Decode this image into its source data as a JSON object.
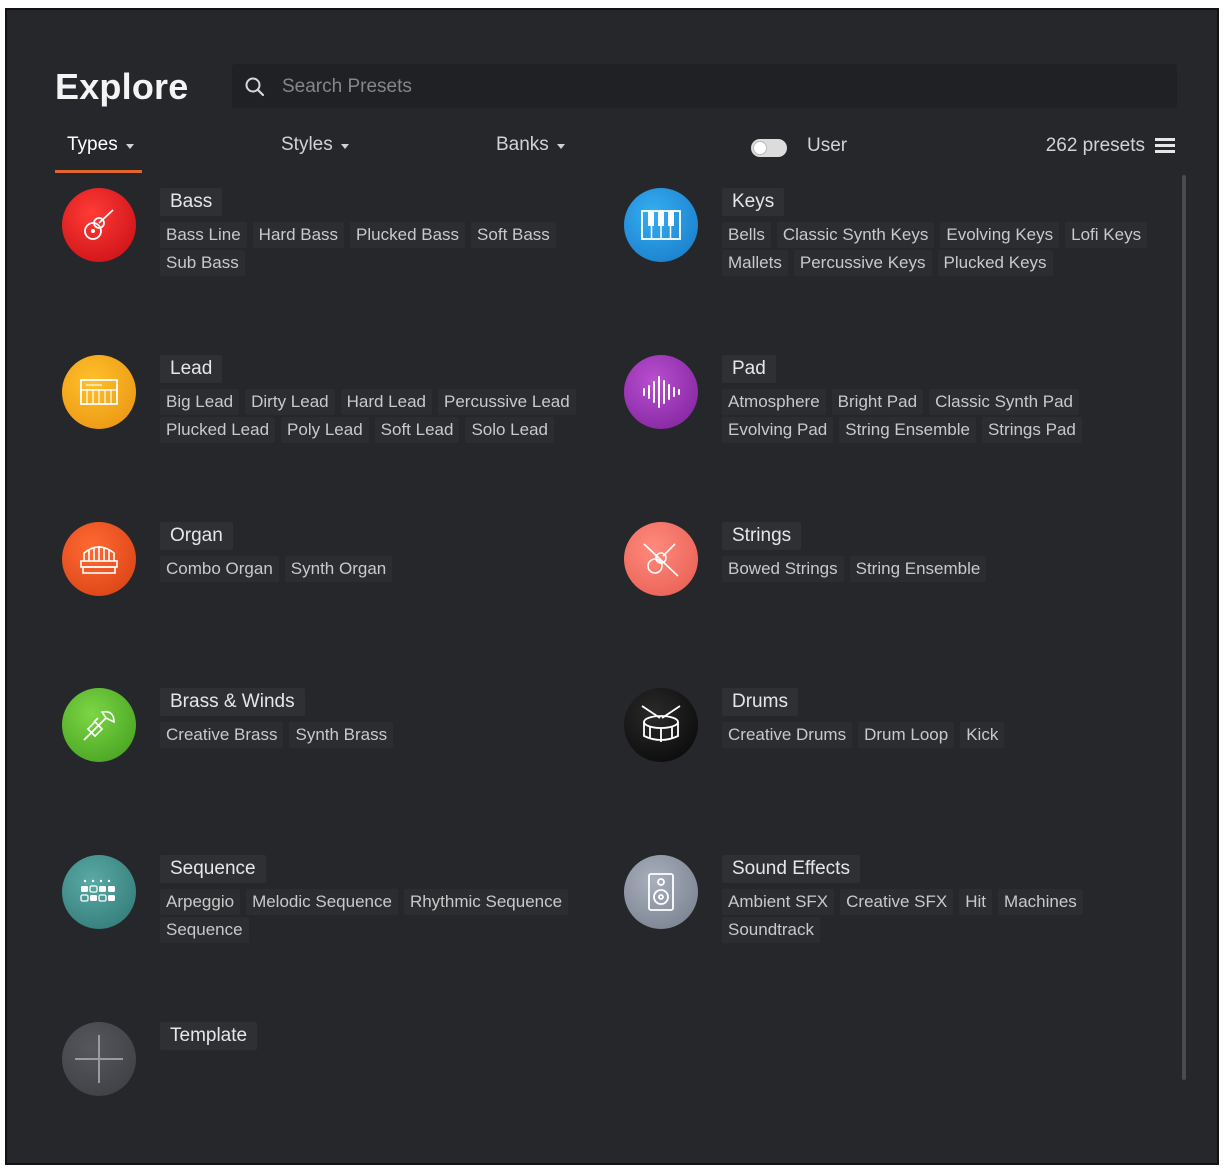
{
  "header": {
    "title": "Explore",
    "search_placeholder": "Search Presets"
  },
  "filters": {
    "types": "Types",
    "styles": "Styles",
    "banks": "Banks",
    "user_label": "User",
    "preset_count": "262 presets"
  },
  "types": {
    "bass": {
      "name": "Bass",
      "tags": [
        "Bass Line",
        "Hard Bass",
        "Plucked Bass",
        "Soft Bass",
        "Sub Bass"
      ]
    },
    "keys": {
      "name": "Keys",
      "tags": [
        "Bells",
        "Classic Synth Keys",
        "Evolving Keys",
        "Lofi Keys",
        "Mallets",
        "Percussive Keys",
        "Plucked Keys"
      ]
    },
    "lead": {
      "name": "Lead",
      "tags": [
        "Big Lead",
        "Dirty Lead",
        "Hard Lead",
        "Percussive Lead",
        "Plucked Lead",
        "Poly Lead",
        "Soft Lead",
        "Solo Lead"
      ]
    },
    "pad": {
      "name": "Pad",
      "tags": [
        "Atmosphere",
        "Bright Pad",
        "Classic Synth Pad",
        "Evolving Pad",
        "String Ensemble",
        "Strings Pad"
      ]
    },
    "organ": {
      "name": "Organ",
      "tags": [
        "Combo Organ",
        "Synth Organ"
      ]
    },
    "strings": {
      "name": "Strings",
      "tags": [
        "Bowed Strings",
        "String Ensemble"
      ]
    },
    "brass": {
      "name": "Brass & Winds",
      "tags": [
        "Creative Brass",
        "Synth Brass"
      ]
    },
    "drums": {
      "name": "Drums",
      "tags": [
        "Creative Drums",
        "Drum Loop",
        "Kick"
      ]
    },
    "sequence": {
      "name": "Sequence",
      "tags": [
        "Arpeggio",
        "Melodic Sequence",
        "Rhythmic Sequence",
        "Sequence"
      ]
    },
    "sfx": {
      "name": "Sound Effects",
      "tags": [
        "Ambient SFX",
        "Creative SFX",
        "Hit",
        "Machines",
        "Soundtrack"
      ]
    },
    "template": {
      "name": "Template",
      "tags": []
    }
  },
  "icons": {
    "bass": "guitar-icon",
    "keys": "piano-keys-icon",
    "lead": "synth-keyboard-icon",
    "pad": "waveform-icon",
    "organ": "organ-icon",
    "strings": "violin-icon",
    "brass": "trumpet-icon",
    "drums": "drum-icon",
    "sequence": "step-grid-icon",
    "sfx": "speaker-icon",
    "template": "plus-icon"
  },
  "colors": {
    "background": "#26272b",
    "accent": "#e0662b",
    "bass": "#d8131c",
    "keys": "#1c8fd9",
    "lead": "#f0a412",
    "pad": "#9a2fb0",
    "organ": "#e8501b",
    "strings": "#f06a5e",
    "brass": "#5dbb2e",
    "drums": "#111111",
    "sequence": "#3b8c8a",
    "sfx": "#8f97a6",
    "template": "#4a4b4f"
  }
}
